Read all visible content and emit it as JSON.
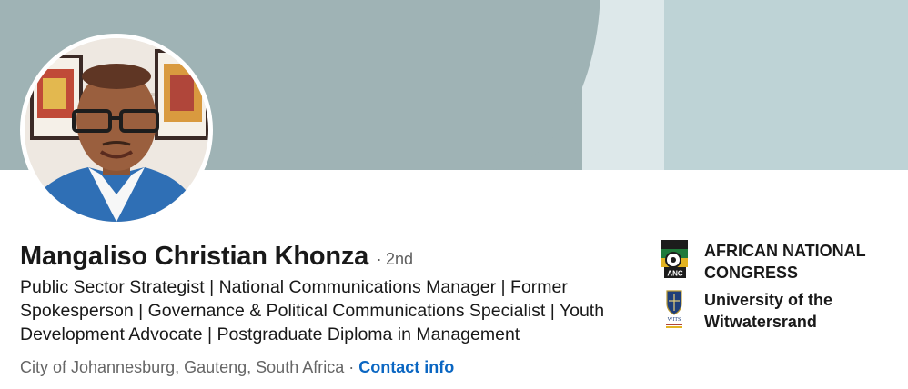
{
  "profile": {
    "name": "Mangaliso Christian Khonza",
    "separator": "·",
    "degree": "2nd",
    "headline": "Public Sector Strategist | National Communications Manager | Former Spokesperson | Governance & Political Communications Specialist | Youth Development Advocate | Postgraduate Diploma in Management",
    "location": "City of Johannesburg, Gauteng, South Africa",
    "location_separator": " · ",
    "contact_label": "Contact info"
  },
  "organizations": [
    {
      "name": "AFRICAN NATIONAL CONGRESS",
      "icon": "anc-logo-icon",
      "logo_text": "ANC"
    },
    {
      "name": "University of the Witwatersrand",
      "icon": "wits-logo-icon",
      "logo_text": "WITS"
    }
  ],
  "colors": {
    "banner": "#9fb3b5",
    "banner_light": "#dde8ea",
    "banner_right": "#bed3d6",
    "link": "#0a66c2"
  }
}
